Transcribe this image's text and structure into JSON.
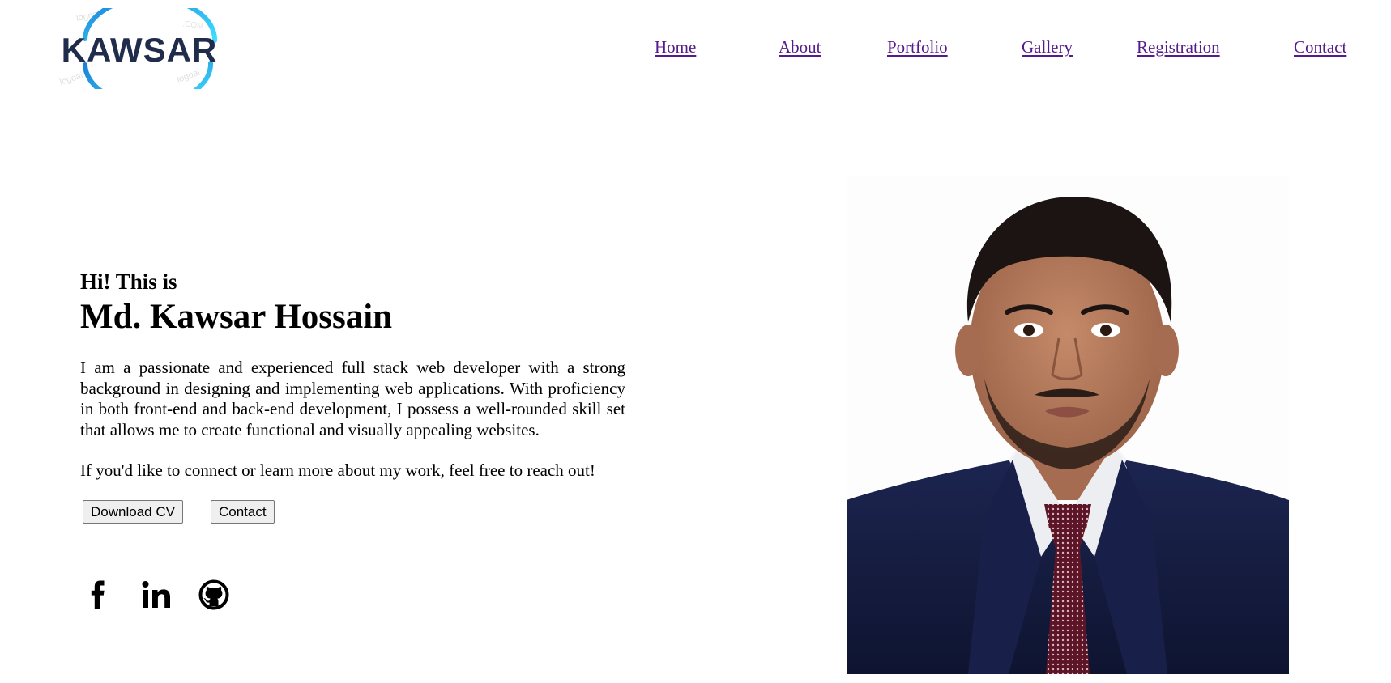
{
  "logo": {
    "text": "KAWSAR",
    "watermark": "logoai.COM",
    "colors": {
      "text": "#1f2c4c",
      "ring_start": "#1a7fd8",
      "ring_end": "#3fe0ff"
    }
  },
  "nav": {
    "items": [
      {
        "label": "Home"
      },
      {
        "label": "About"
      },
      {
        "label": "Portfolio"
      },
      {
        "label": "Gallery"
      },
      {
        "label": "Registration"
      },
      {
        "label": "Contact"
      }
    ],
    "link_color": "#551a8b"
  },
  "hero": {
    "greeting": "Hi! This is",
    "name": "Md. Kawsar Hossain",
    "bio": "I am a passionate and experienced full stack web developer with a strong background in designing and implementing web applications. With proficiency in both front-end and back-end development, I possess a well-rounded skill set that allows me to create functional and visually appealing websites.",
    "cta_text": "If you'd like to connect or learn more about my work, feel free to reach out!",
    "buttons": {
      "download_cv": "Download CV",
      "contact": "Contact"
    },
    "socials": [
      {
        "icon": "facebook-icon"
      },
      {
        "icon": "linkedin-icon"
      },
      {
        "icon": "github-icon"
      }
    ]
  },
  "photo": {
    "icon": "profile-photo",
    "colors": {
      "suit": "#141c3d",
      "skin": "#b07a5c",
      "hair": "#1b1412",
      "tie": "#6e1a2e",
      "shirt": "#f4f4f6"
    }
  }
}
